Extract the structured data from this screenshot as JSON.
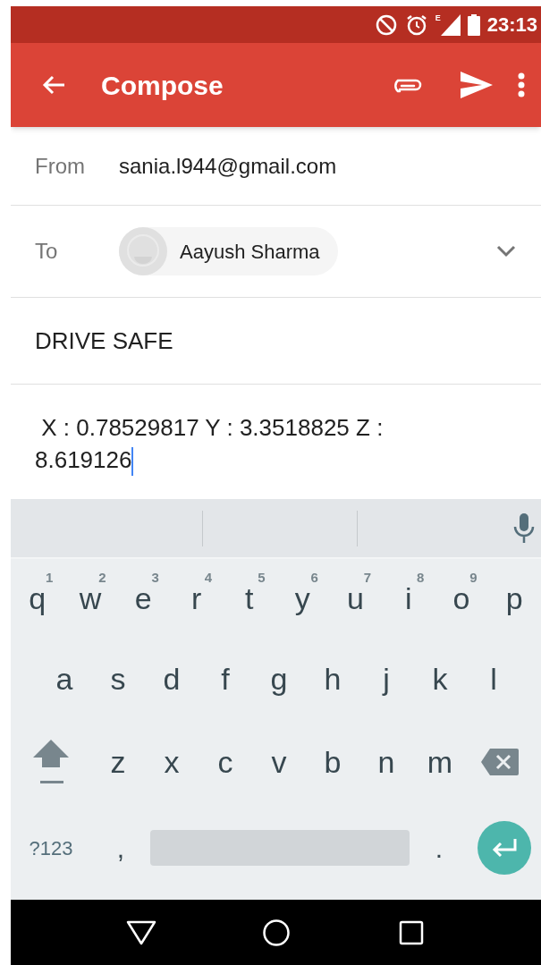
{
  "status_bar": {
    "time": "23:13",
    "network": "E"
  },
  "app_bar": {
    "title": "Compose"
  },
  "from": {
    "label": "From",
    "value": "sania.l944@gmail.com"
  },
  "to": {
    "label": "To",
    "recipients": [
      {
        "name": "Aayush Sharma"
      }
    ],
    "expanded": false
  },
  "subject": {
    "value": "DRIVE SAFE"
  },
  "body": {
    "value": " X : 0.78529817 Y : 3.3518825 Z : 8.619126"
  },
  "keyboard": {
    "top_row": [
      {
        "kind": "letter",
        "label": "q",
        "hint": "1"
      },
      {
        "kind": "letter",
        "label": "w",
        "hint": "2"
      },
      {
        "kind": "letter",
        "label": "e",
        "hint": "3"
      },
      {
        "kind": "letter",
        "label": "r",
        "hint": "4"
      },
      {
        "kind": "letter",
        "label": "t",
        "hint": "5"
      },
      {
        "kind": "letter",
        "label": "y",
        "hint": "6"
      },
      {
        "kind": "letter",
        "label": "u",
        "hint": "7"
      },
      {
        "kind": "letter",
        "label": "i",
        "hint": "8"
      },
      {
        "kind": "letter",
        "label": "o",
        "hint": "9"
      },
      {
        "kind": "letter",
        "label": "p"
      }
    ],
    "home_row": [
      {
        "kind": "letter",
        "label": "a"
      },
      {
        "kind": "letter",
        "label": "s"
      },
      {
        "kind": "letter",
        "label": "d"
      },
      {
        "kind": "letter",
        "label": "f"
      },
      {
        "kind": "letter",
        "label": "g"
      },
      {
        "kind": "letter",
        "label": "h"
      },
      {
        "kind": "letter",
        "label": "j"
      },
      {
        "kind": "letter",
        "label": "k"
      },
      {
        "kind": "letter",
        "label": "l"
      }
    ],
    "bottom_row": [
      {
        "kind": "shift"
      },
      {
        "kind": "letter",
        "label": "z"
      },
      {
        "kind": "letter",
        "label": "x"
      },
      {
        "kind": "letter",
        "label": "c"
      },
      {
        "kind": "letter",
        "label": "v"
      },
      {
        "kind": "letter",
        "label": "b"
      },
      {
        "kind": "letter",
        "label": "n"
      },
      {
        "kind": "letter",
        "label": "m"
      },
      {
        "kind": "backspace"
      }
    ],
    "function_row": [
      {
        "kind": "symbols",
        "label": "?123"
      },
      {
        "kind": "punct",
        "label": ","
      },
      {
        "kind": "space"
      },
      {
        "kind": "punct",
        "label": "."
      },
      {
        "kind": "enter"
      }
    ]
  }
}
